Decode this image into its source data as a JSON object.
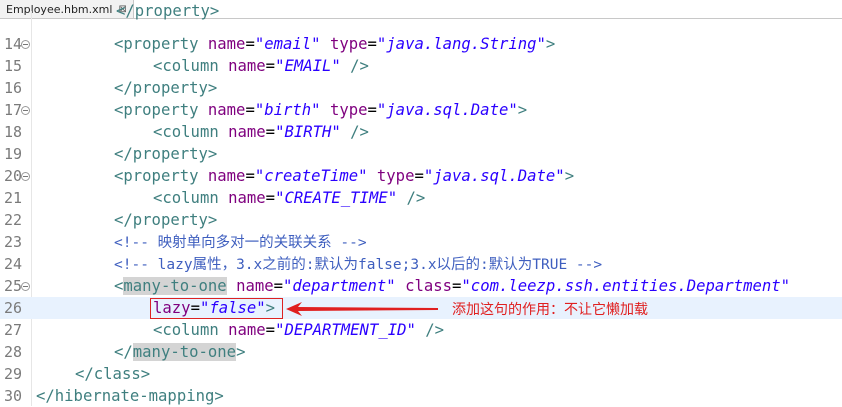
{
  "tab": {
    "title": "Employee.hbm.xml",
    "close_symbol": "⊠"
  },
  "cursor_line": 26,
  "lines": [
    {
      "num": "15",
      "fold": false,
      "indent": 2,
      "tokens": []
    },
    {
      "num": "14",
      "fold": true
    },
    {
      "num": "15",
      "fold": false
    },
    {
      "num": "16",
      "fold": false
    },
    {
      "num": "17",
      "fold": true
    },
    {
      "num": "18",
      "fold": false
    },
    {
      "num": "19",
      "fold": false
    },
    {
      "num": "20",
      "fold": true
    },
    {
      "num": "21",
      "fold": false
    },
    {
      "num": "22",
      "fold": false
    },
    {
      "num": "23",
      "fold": false
    },
    {
      "num": "24",
      "fold": false
    },
    {
      "num": "25",
      "fold": true
    },
    {
      "num": "26",
      "fold": false
    },
    {
      "num": "27",
      "fold": false
    },
    {
      "num": "28",
      "fold": false
    },
    {
      "num": "29",
      "fold": false
    },
    {
      "num": "30",
      "fold": false
    }
  ],
  "code": {
    "l13": "</property>",
    "l14": {
      "open": "<property",
      "a1": "name",
      "v1": "\"email\"",
      "a2": "type",
      "v2": "\"java.lang.String\"",
      "close": ">"
    },
    "l15": {
      "open": "<column",
      "a1": "name",
      "v1": "\"EMAIL\"",
      "close": "/>"
    },
    "l16": "</property>",
    "l17": {
      "open": "<property",
      "a1": "name",
      "v1": "\"birth\"",
      "a2": "type",
      "v2": "\"java.sql.Date\"",
      "close": ">"
    },
    "l18": {
      "open": "<column",
      "a1": "name",
      "v1": "\"BIRTH\"",
      "close": "/>"
    },
    "l19": "</property>",
    "l20": {
      "open": "<property",
      "a1": "name",
      "v1": "\"createTime\"",
      "a2": "type",
      "v2": "\"java.sql.Date\"",
      "close": ">"
    },
    "l21": {
      "open": "<column",
      "a1": "name",
      "v1": "\"CREATE_TIME\"",
      "close": "/>"
    },
    "l22": "</property>",
    "l23": "<!-- 映射单向多对一的关联关系 -->",
    "l24": "<!-- lazy属性，3.x之前的:默认为false;3.x以后的:默认为TRUE -->",
    "l25": {
      "open_lt": "<",
      "tagname": "many-to-one",
      "a1": "name",
      "v1": "\"department\"",
      "a2": "class",
      "v2": "\"com.leezp.ssh.entities.Department\""
    },
    "l26": {
      "a1": "lazy",
      "v1": "\"false\"",
      "close": ">"
    },
    "l27": {
      "open": "<column",
      "a1": "name",
      "v1": "\"DEPARTMENT_ID\"",
      "close": "/>"
    },
    "l28": {
      "open_lt": "</",
      "tagname": "many-to-one",
      "close": ">"
    },
    "l29": "</class>",
    "l30": "</hibernate-mapping>"
  },
  "annotation": {
    "text": "添加这句的作用：不让它懒加载",
    "color": "#e02020"
  },
  "colors": {
    "tag": "#3f7f7f",
    "attribute": "#7f007f",
    "value": "#2a00ff",
    "comment": "#3f5fbf",
    "current_line": "#e8f2fe"
  }
}
